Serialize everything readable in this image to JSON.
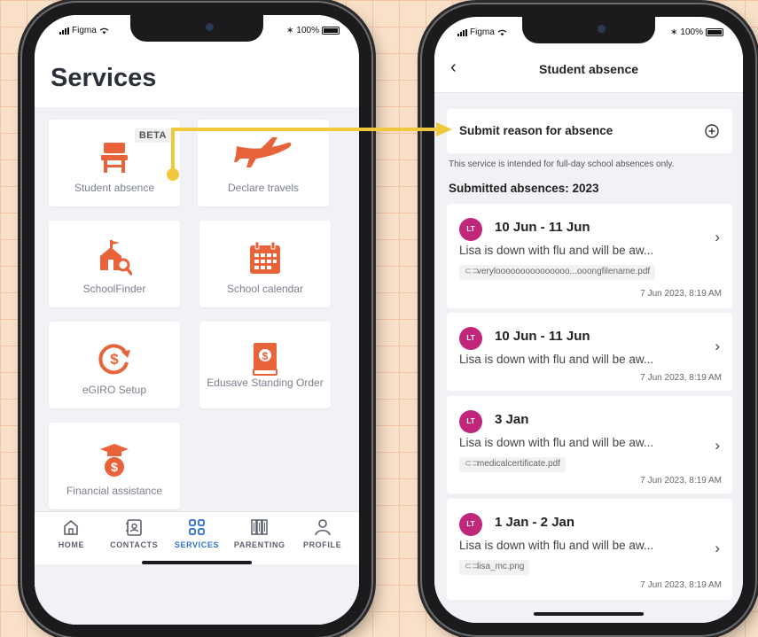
{
  "status": {
    "carrier": "Figma",
    "battery": "100%"
  },
  "left": {
    "title": "Services",
    "tiles": [
      {
        "label": "Student absence",
        "badge": "BETA",
        "icon": "student-desk-icon"
      },
      {
        "label": "Declare travels",
        "icon": "airplane-icon"
      },
      {
        "label": "SchoolFinder",
        "icon": "school-search-icon"
      },
      {
        "label": "School calendar",
        "icon": "calendar-icon"
      },
      {
        "label": "eGIRO Setup",
        "icon": "recurring-payment-icon"
      },
      {
        "label": "Edusave Standing Order",
        "icon": "edusave-book-icon"
      },
      {
        "label": "Financial assistance",
        "icon": "graduation-money-icon"
      }
    ],
    "nav": [
      {
        "label": "HOME",
        "icon": "home-icon"
      },
      {
        "label": "CONTACTS",
        "icon": "contacts-icon"
      },
      {
        "label": "SERVICES",
        "icon": "services-grid-icon",
        "active": true
      },
      {
        "label": "PARENTING",
        "icon": "books-icon"
      },
      {
        "label": "PROFILE",
        "icon": "profile-icon"
      }
    ]
  },
  "right": {
    "title": "Student absence",
    "back_icon": "chevron-left-icon",
    "submit_label": "Submit reason for absence",
    "note": "This service is intended for full-day school absences only.",
    "submitted_heading": "Submitted absences: 2023",
    "absences": [
      {
        "initials": "LT",
        "dates": "10 Jun - 11 Jun",
        "desc": "Lisa is down with flu and will be aw...",
        "file": "verylooooooooooooooo...ooongfilename.pdf",
        "time": "7 Jun 2023, 8:19 AM"
      },
      {
        "initials": "LT",
        "dates": "10 Jun - 11 Jun",
        "desc": "Lisa is down with flu and will be aw...",
        "time": "7 Jun 2023, 8:19 AM"
      },
      {
        "initials": "LT",
        "dates": "3 Jan",
        "desc": "Lisa is down with flu and will be aw...",
        "file": "medicalcertificate.pdf",
        "time": "7 Jun 2023, 8:19 AM"
      },
      {
        "initials": "LT",
        "dates": "1 Jan - 2 Jan",
        "desc": "Lisa is down with flu and will be aw...",
        "file": "lisa_mc.png",
        "time": "7 Jun 2023, 8:19 AM"
      }
    ]
  },
  "colors": {
    "accent_orange": "#e8623a",
    "active_blue": "#2d6fd4",
    "avatar_magenta": "#c0277b",
    "arrow_yellow": "#f0c83c"
  }
}
